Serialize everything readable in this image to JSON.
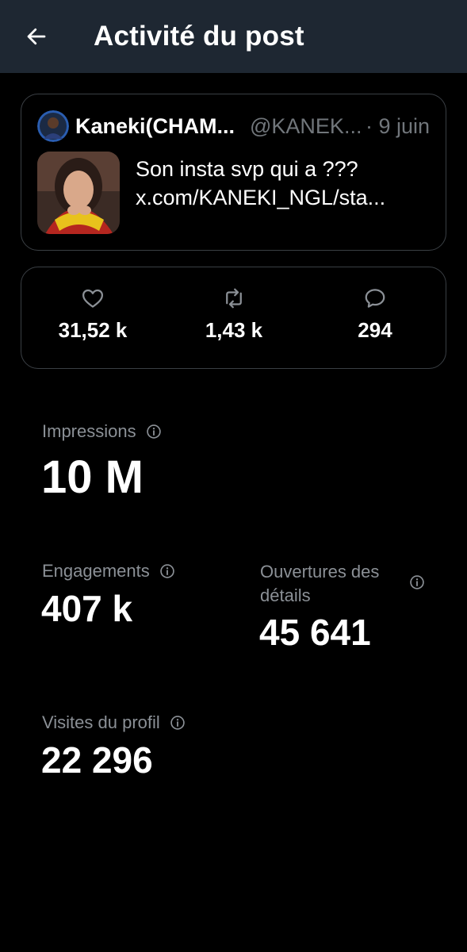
{
  "header": {
    "title": "Activité du post",
    "back_icon": "arrow-left-icon"
  },
  "post": {
    "author_name": "Kaneki(CHAM...",
    "author_handle": "@KANEK...",
    "date": "· 9 juin",
    "text_line1": "Son insta svp qui a ???",
    "text_line2": "x.com/KANEKI_NGL/sta..."
  },
  "metrics": {
    "likes": {
      "icon": "heart-icon",
      "value": "31,52 k"
    },
    "reposts": {
      "icon": "repost-icon",
      "value": "1,43 k"
    },
    "replies": {
      "icon": "reply-icon",
      "value": "294"
    }
  },
  "stats": {
    "impressions": {
      "label": "Impressions",
      "value": "10 M"
    },
    "engagements": {
      "label": "Engagements",
      "value": "407 k"
    },
    "detail_expands": {
      "label_line1": "Ouvertures des",
      "label_line2": "détails",
      "value": "45 641"
    },
    "profile_visits": {
      "label": "Visites du profil",
      "value": "22 296"
    }
  },
  "colors": {
    "background": "#000000",
    "header_bg": "#1e2732",
    "border": "#3a3f44",
    "secondary_text": "#71767b",
    "label_text": "#8b9096",
    "primary_text": "#ffffff"
  }
}
